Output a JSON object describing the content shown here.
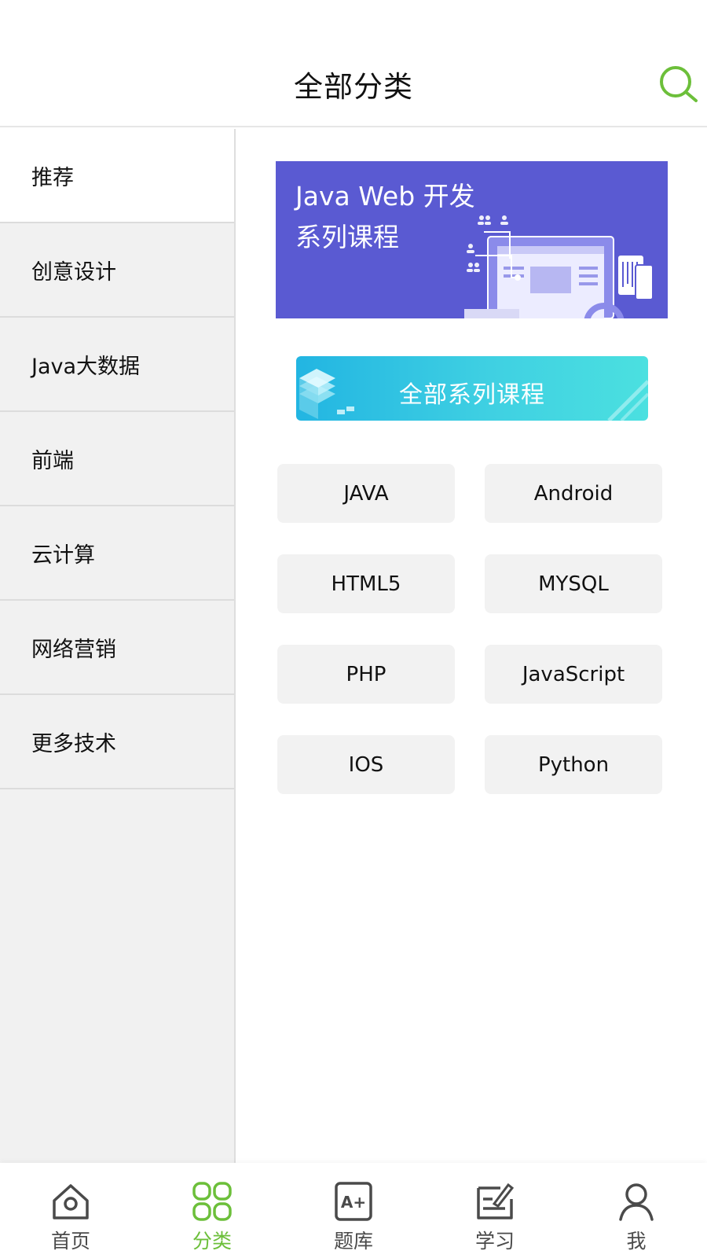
{
  "header": {
    "title": "全部分类",
    "search_icon": "search-icon"
  },
  "sidebar": {
    "items": [
      {
        "label": "推荐",
        "active": true
      },
      {
        "label": "创意设计"
      },
      {
        "label": "Java大数据"
      },
      {
        "label": "前端"
      },
      {
        "label": "云计算"
      },
      {
        "label": "网络营销"
      },
      {
        "label": "更多技术"
      }
    ]
  },
  "banner": {
    "line1": "Java Web 开发",
    "line2": "系列课程",
    "background": "#5a5ad2"
  },
  "all_courses": {
    "label": "全部系列课程"
  },
  "tags": [
    "JAVA",
    "Android",
    "HTML5",
    "MYSQL",
    "PHP",
    "JavaScript",
    "IOS",
    "Python"
  ],
  "bottom_nav": {
    "items": [
      {
        "label": "首页",
        "icon": "home-icon"
      },
      {
        "label": "分类",
        "icon": "category-grid-icon",
        "active": true
      },
      {
        "label": "题库",
        "icon": "question-bank-icon"
      },
      {
        "label": "学习",
        "icon": "study-icon"
      },
      {
        "label": "我",
        "icon": "profile-icon"
      }
    ]
  },
  "colors": {
    "accent": "#6cbf3a",
    "sidebar_bg": "#f1f1f1",
    "tag_bg": "#f2f2f2"
  }
}
